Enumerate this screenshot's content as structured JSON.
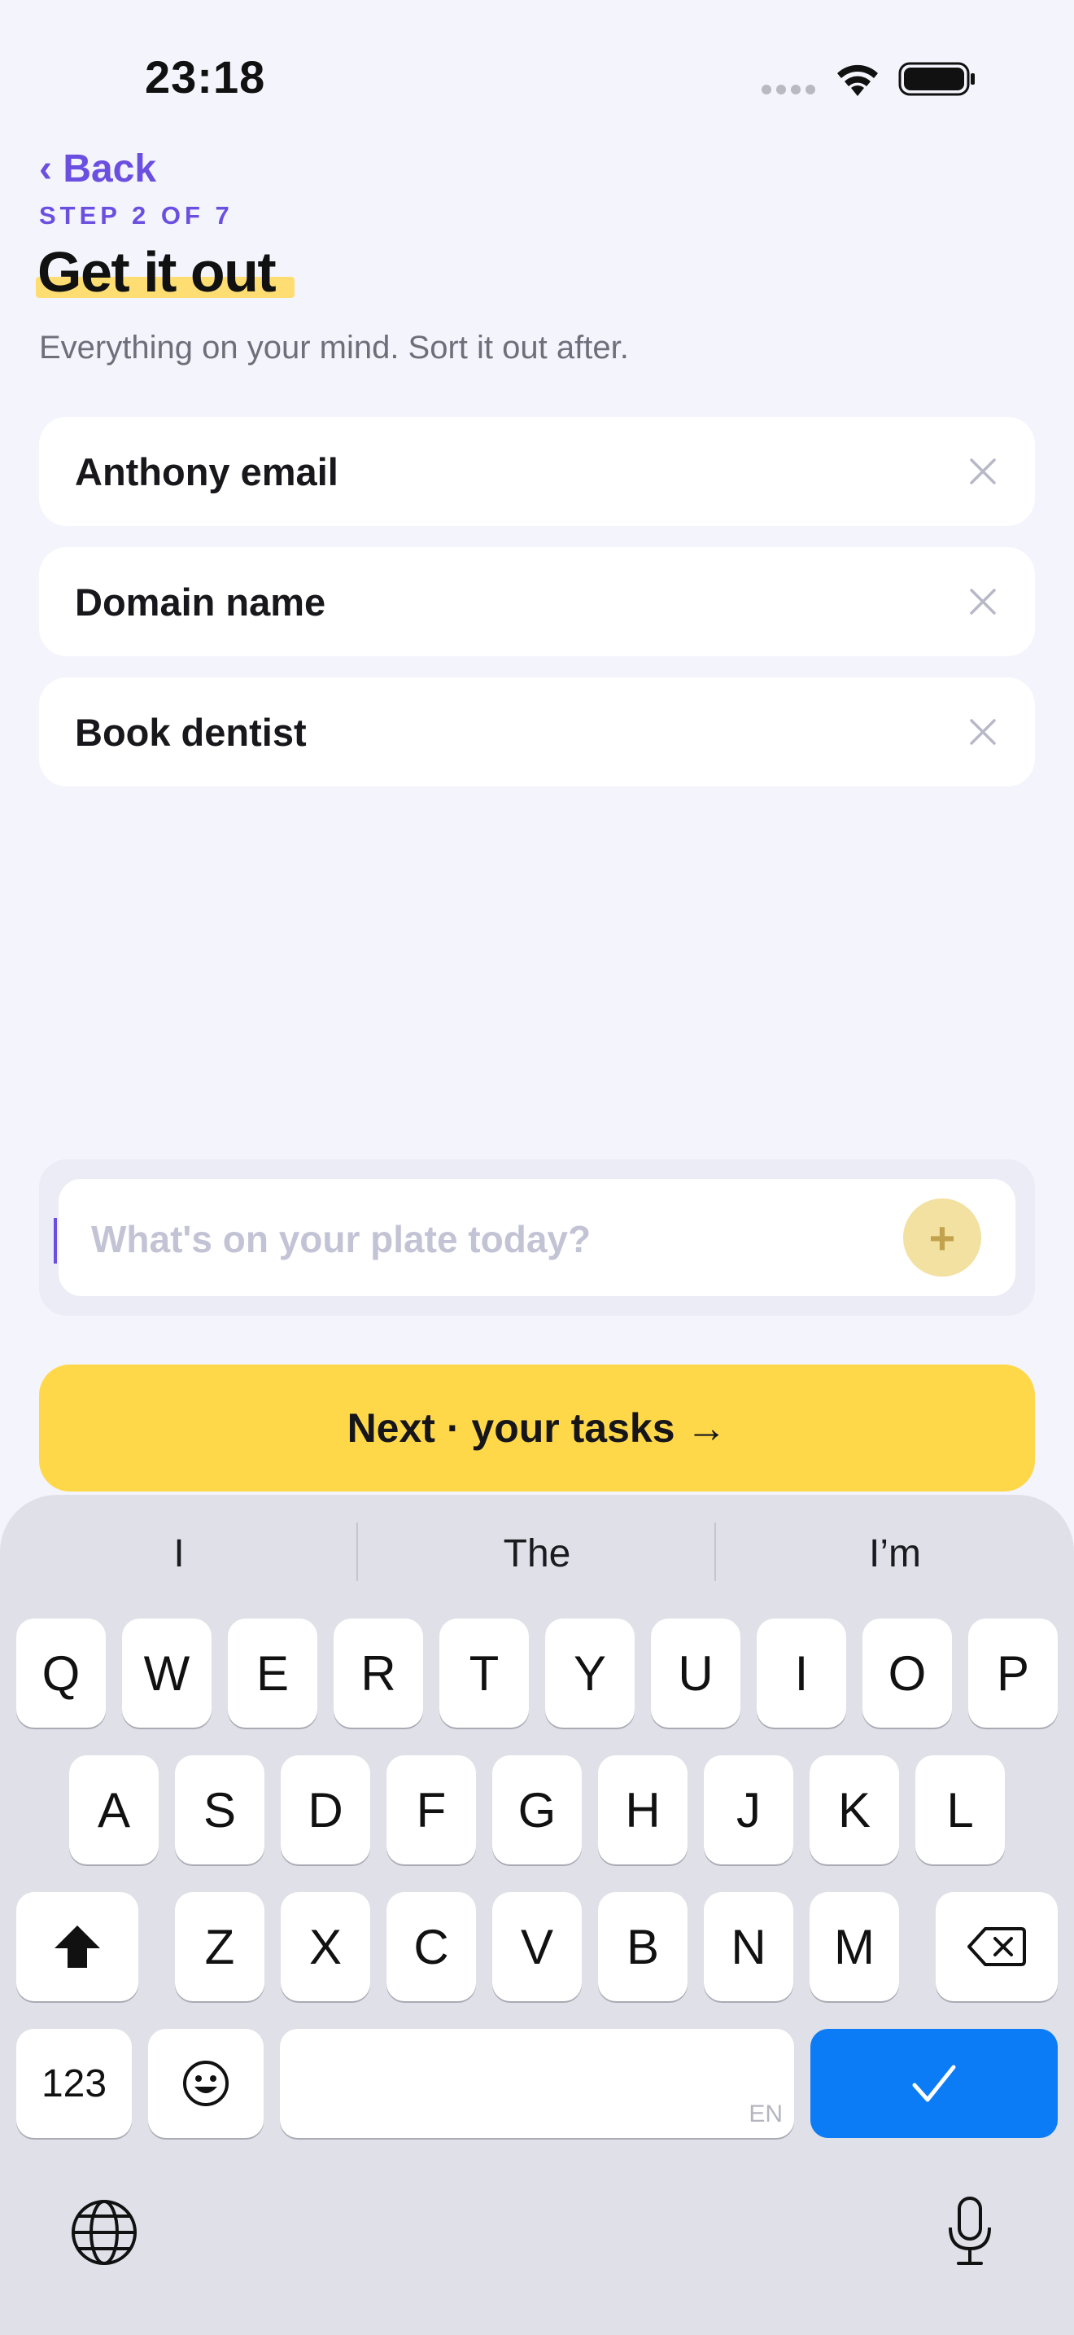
{
  "status_bar": {
    "time": "23:18"
  },
  "header": {
    "back_label": "‹ Back",
    "step_label": "STEP 2 OF 7",
    "title": "Get it out",
    "subtitle": "Everything on your mind. Sort it out after."
  },
  "tasks": [
    {
      "label": "Anthony email"
    },
    {
      "label": "Domain name"
    },
    {
      "label": "Book dentist"
    }
  ],
  "input": {
    "placeholder": "What's on your plate today?",
    "add_label": "+"
  },
  "next_button": {
    "label": "Next · your tasks →"
  },
  "keyboard": {
    "suggestions": [
      "I",
      "The",
      "I’m"
    ],
    "row1": [
      "Q",
      "W",
      "E",
      "R",
      "T",
      "Y",
      "U",
      "I",
      "O",
      "P"
    ],
    "row2": [
      "A",
      "S",
      "D",
      "F",
      "G",
      "H",
      "J",
      "K",
      "L"
    ],
    "row3": [
      "Z",
      "X",
      "C",
      "V",
      "B",
      "N",
      "M"
    ],
    "numbers_label": "123",
    "space_lang": "EN"
  },
  "colors": {
    "accent": "#6b4fe0",
    "primary_button": "#ffd84a",
    "return_key": "#0b7cf6"
  }
}
